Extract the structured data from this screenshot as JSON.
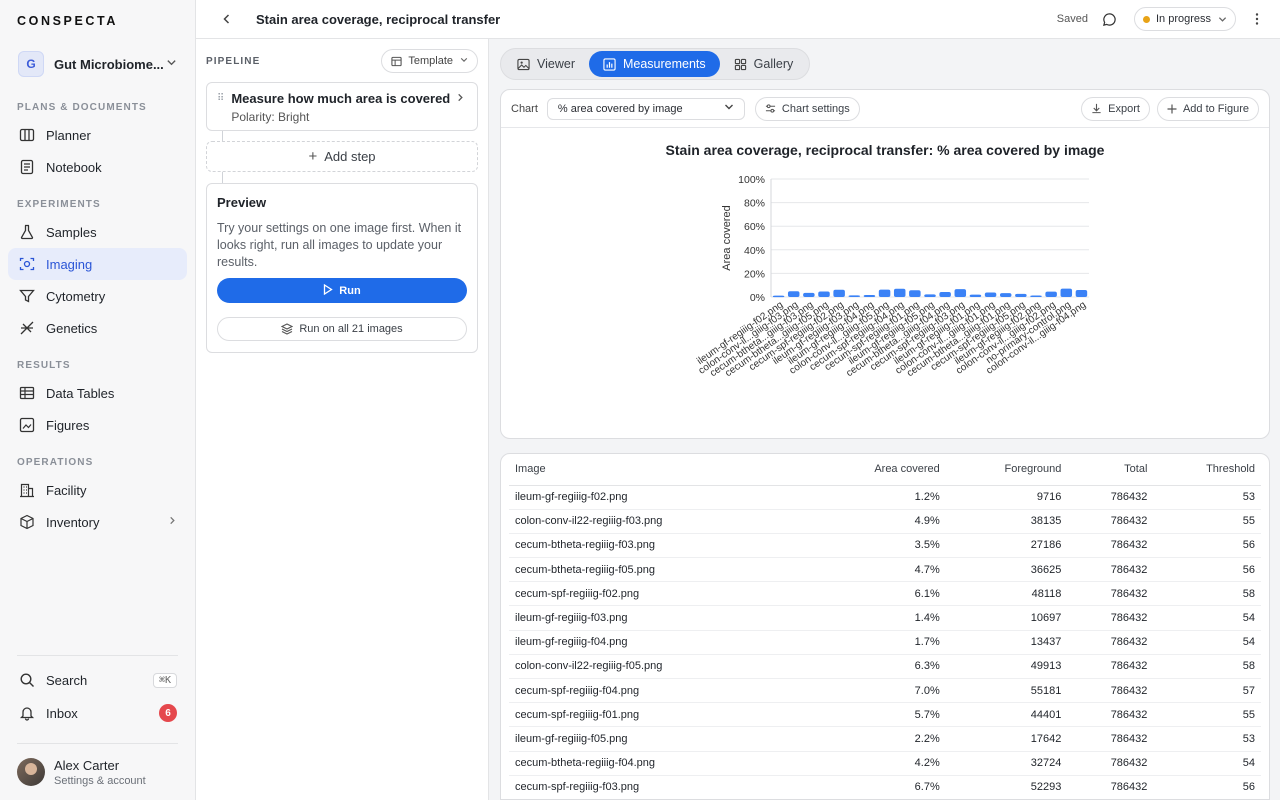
{
  "sidebar": {
    "brand": "CONSPECTA",
    "workspace": {
      "initial": "G",
      "name": "Gut Microbiome..."
    },
    "sections": {
      "plans": "PLANS & DOCUMENTS",
      "experiments": "EXPERIMENTS",
      "results": "RESULTS",
      "operations": "OPERATIONS"
    },
    "items": {
      "planner": "Planner",
      "notebook": "Notebook",
      "samples": "Samples",
      "imaging": "Imaging",
      "cytometry": "Cytometry",
      "genetics": "Genetics",
      "data_tables": "Data Tables",
      "figures": "Figures",
      "facility": "Facility",
      "inventory": "Inventory"
    },
    "search": {
      "label": "Search",
      "shortcut": "⌘K"
    },
    "inbox": {
      "label": "Inbox",
      "count": "6"
    },
    "user": {
      "name": "Alex Carter",
      "subtitle": "Settings & account"
    }
  },
  "topbar": {
    "title": "Stain area coverage, reciprocal transfer",
    "saved": "Saved",
    "status": "In progress",
    "status_color": "#e8a317"
  },
  "pipeline": {
    "label": "PIPELINE",
    "template_label": "Template",
    "step": {
      "title": "Measure how much area is covered",
      "subtitle": "Polarity: Bright"
    },
    "add_step": "Add step",
    "preview": {
      "title": "Preview",
      "text": "Try your settings on one image first. When it looks right, run all images to update your results.",
      "run": "Run",
      "run_all": "Run on all 21 images"
    }
  },
  "tabs": {
    "viewer": "Viewer",
    "measurements": "Measurements",
    "gallery": "Gallery"
  },
  "chart_toolbar": {
    "chart_label": "Chart",
    "selected": "% area covered by image",
    "settings": "Chart settings",
    "export": "Export",
    "add_to_figure": "Add to Figure"
  },
  "chart_data": {
    "type": "bar",
    "title": "Stain area coverage, reciprocal transfer: % area covered by image",
    "xlabel": "",
    "ylabel": "Area covered",
    "ylim": [
      0,
      100
    ],
    "yticks": [
      "0%",
      "20%",
      "40%",
      "60%",
      "80%",
      "100%"
    ],
    "bar_color": "#3b82f6",
    "grid": true,
    "categories": [
      "ileum-gf-regiiig-f02.png",
      "colon-conv-il...giiig-f03.png",
      "cecum-btheta...giiig-f03.png",
      "cecum-btheta...giiig-f05.png",
      "cecum-spf-regiiig-f02.png",
      "ileum-gf-regiiig-f03.png",
      "ileum-gf-regiiig-f04.png",
      "colon-conv-il...giiig-f05.png",
      "cecum-spf-regiiig-f04.png",
      "cecum-spf-regiiig-f01.png",
      "ileum-gf-regiiig-f05.png",
      "cecum-btheta...giiig-f04.png",
      "cecum-spf-regiiig-f03.png",
      "ileum-gf-regiiig-f01.png",
      "colon-conv-il...giiig-f01.png",
      "cecum-btheta...giiig-f01.png",
      "cecum-spf-regiiig-f05.png",
      "ileum-gf-regiiig-f02.png",
      "colon-conv-il...giiig-f02.png",
      "no-primary-control.png",
      "colon-conv-il...giiig-f04.png"
    ],
    "values": [
      1.2,
      4.9,
      3.5,
      4.7,
      6.1,
      1.4,
      1.7,
      6.3,
      7.0,
      5.7,
      2.2,
      4.2,
      6.7,
      2.0,
      3.8,
      3.3,
      2.6,
      1.3,
      4.6,
      7.1,
      5.9
    ]
  },
  "table": {
    "columns": [
      "Image",
      "Area covered",
      "Foreground",
      "Total",
      "Threshold"
    ],
    "rows": [
      [
        "ileum-gf-regiiig-f02.png",
        "1.2%",
        "9716",
        "786432",
        "53"
      ],
      [
        "colon-conv-il22-regiiig-f03.png",
        "4.9%",
        "38135",
        "786432",
        "55"
      ],
      [
        "cecum-btheta-regiiig-f03.png",
        "3.5%",
        "27186",
        "786432",
        "56"
      ],
      [
        "cecum-btheta-regiiig-f05.png",
        "4.7%",
        "36625",
        "786432",
        "56"
      ],
      [
        "cecum-spf-regiiig-f02.png",
        "6.1%",
        "48118",
        "786432",
        "58"
      ],
      [
        "ileum-gf-regiiig-f03.png",
        "1.4%",
        "10697",
        "786432",
        "54"
      ],
      [
        "ileum-gf-regiiig-f04.png",
        "1.7%",
        "13437",
        "786432",
        "54"
      ],
      [
        "colon-conv-il22-regiiig-f05.png",
        "6.3%",
        "49913",
        "786432",
        "58"
      ],
      [
        "cecum-spf-regiiig-f04.png",
        "7.0%",
        "55181",
        "786432",
        "57"
      ],
      [
        "cecum-spf-regiiig-f01.png",
        "5.7%",
        "44401",
        "786432",
        "55"
      ],
      [
        "ileum-gf-regiiig-f05.png",
        "2.2%",
        "17642",
        "786432",
        "53"
      ],
      [
        "cecum-btheta-regiiig-f04.png",
        "4.2%",
        "32724",
        "786432",
        "54"
      ],
      [
        "cecum-spf-regiiig-f03.png",
        "6.7%",
        "52293",
        "786432",
        "56"
      ]
    ]
  }
}
